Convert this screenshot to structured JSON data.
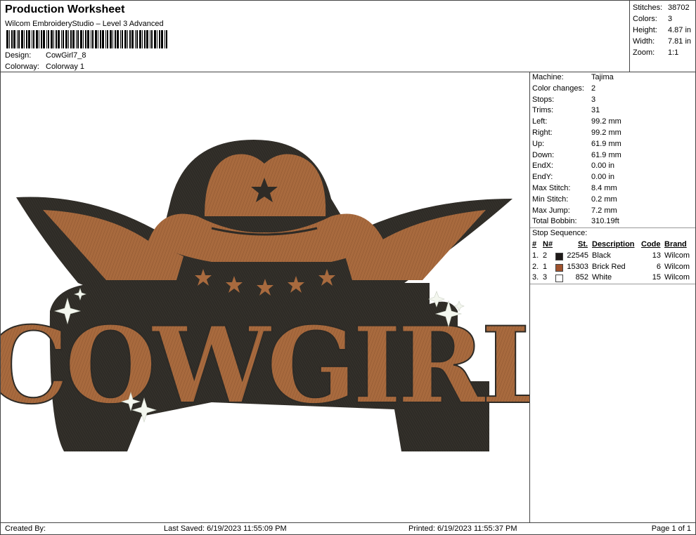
{
  "header": {
    "title": "Production Worksheet",
    "subtitle": "Wilcom EmbroideryStudio – Level 3 Advanced",
    "design_label": "Design:",
    "design_value": "CowGirl7_8",
    "colorway_label": "Colorway:",
    "colorway_value": "Colorway 1"
  },
  "stats": [
    {
      "label": "Stitches:",
      "value": "38702"
    },
    {
      "label": "Colors:",
      "value": "3"
    },
    {
      "label": "Height:",
      "value": "4.87 in"
    },
    {
      "label": "Width:",
      "value": "7.81 in"
    },
    {
      "label": "Zoom:",
      "value": "1:1"
    }
  ],
  "machine_info": [
    {
      "label": "Machine:",
      "value": "Tajima"
    },
    {
      "label": "Color changes:",
      "value": "2"
    },
    {
      "label": "Stops:",
      "value": "3"
    },
    {
      "label": "Trims:",
      "value": "31"
    },
    {
      "label": "Left:",
      "value": "99.2 mm"
    },
    {
      "label": "Right:",
      "value": "99.2 mm"
    },
    {
      "label": "Up:",
      "value": "61.9 mm"
    },
    {
      "label": "Down:",
      "value": "61.9 mm"
    },
    {
      "label": "EndX:",
      "value": "0.00 in"
    },
    {
      "label": "EndY:",
      "value": "0.00 in"
    },
    {
      "label": "Max Stitch:",
      "value": "8.4 mm"
    },
    {
      "label": "Min Stitch:",
      "value": "0.2 mm"
    },
    {
      "label": "Max Jump:",
      "value": "7.2 mm"
    },
    {
      "label": "Total Bobbin:",
      "value": "310.19ft"
    }
  ],
  "stop_sequence": {
    "title": "Stop Sequence:",
    "headers": {
      "num": "#",
      "n": "N#",
      "st": "St.",
      "desc": "Description",
      "code": "Code",
      "brand": "Brand"
    },
    "rows": [
      {
        "num": "1.",
        "n": "2",
        "color": "#1e1a18",
        "st": "22545",
        "desc": "Black",
        "code": "13",
        "brand": "Wilcom"
      },
      {
        "num": "2.",
        "n": "1",
        "color": "#a0522d",
        "st": "15303",
        "desc": "Brick Red",
        "code": "6",
        "brand": "Wilcom"
      },
      {
        "num": "3.",
        "n": "3",
        "color": "#ffffff",
        "st": "852",
        "desc": "White",
        "code": "15",
        "brand": "Wilcom"
      }
    ]
  },
  "design": {
    "text": "COWGIRL",
    "colors": {
      "outline": "#2e2b26",
      "fill": "#a86a3e",
      "highlight": "#c28552",
      "sparkle": "#f4f7ef"
    }
  },
  "footer": {
    "created": "Created By:",
    "saved": "Last Saved: 6/19/2023 11:55:09 PM",
    "printed": "Printed: 6/19/2023 11:55:37 PM",
    "page": "Page 1 of 1"
  }
}
